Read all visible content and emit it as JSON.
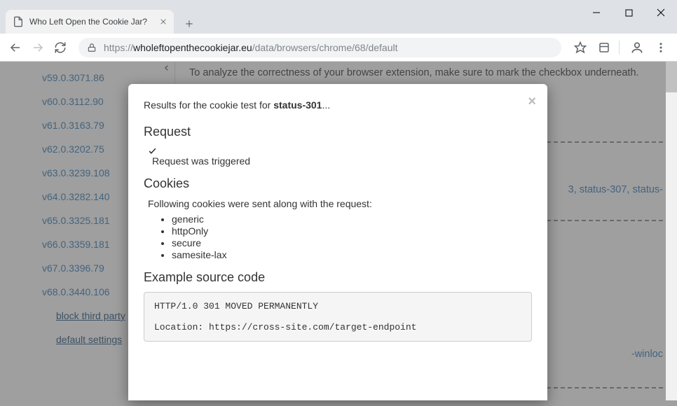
{
  "window": {
    "tab_title": "Who Left Open the Cookie Jar?"
  },
  "toolbar": {
    "url_scheme": "https://",
    "url_host": "wholeftopenthecookiejar.eu",
    "url_path": "/data/browsers/chrome/68/default"
  },
  "sidebar": {
    "versions": [
      "v59.0.3071.86",
      "v60.0.3112.90",
      "v61.0.3163.79",
      "v62.0.3202.75",
      "v63.0.3239.108",
      "v64.0.3282.140",
      "v65.0.3325.181",
      "v66.0.3359.181",
      "v67.0.3396.79",
      "v68.0.3440.106"
    ],
    "sub": [
      "block third party",
      "default settings"
    ]
  },
  "page": {
    "hint": "To analyze the correctness of your browser extension, make sure to mark the checkbox underneath.",
    "peek_links": "3, status-307, status-",
    "peek_right": "-winloc"
  },
  "modal": {
    "title_prefix": "Results for the cookie test for ",
    "title_test": "status-301",
    "title_suffix": "...",
    "h_request": "Request",
    "request_status": "Request was triggered",
    "h_cookies": "Cookies",
    "cookies_intro": "Following cookies were sent along with the request:",
    "cookies": [
      "generic",
      "httpOnly",
      "secure",
      "samesite-lax"
    ],
    "h_code": "Example source code",
    "code": "HTTP/1.0 301 MOVED PERMANENTLY\n\nLocation: https://cross-site.com/target-endpoint"
  }
}
